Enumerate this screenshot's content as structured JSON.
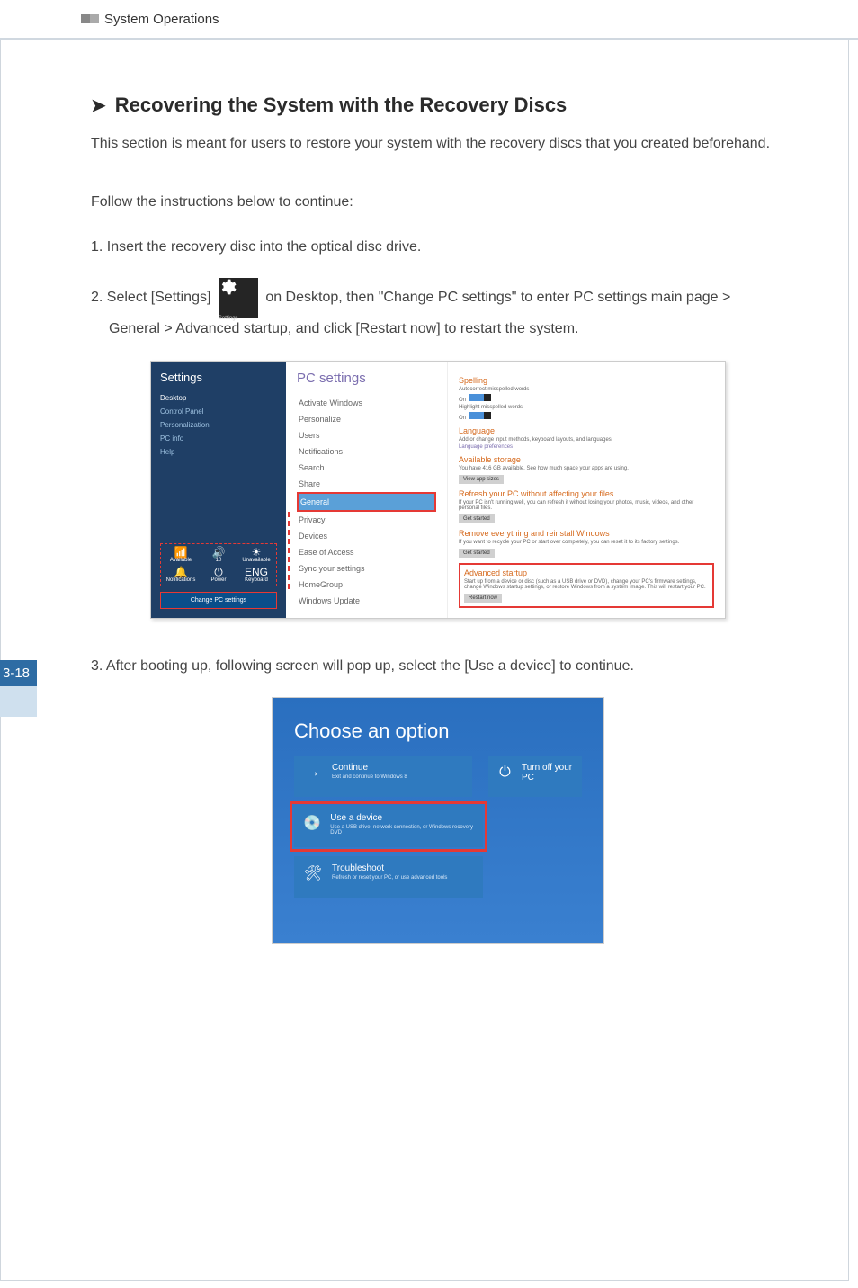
{
  "header": {
    "chapter_title": "System Operations"
  },
  "page_number": "3-18",
  "section": {
    "heading": "Recovering the System with the Recovery Discs",
    "intro": "This section is meant for users to restore your system with the recovery discs that you created beforehand.",
    "instruction_lead": "Follow the instructions below to continue:",
    "step1": "1. Insert the recovery disc into the optical disc drive.",
    "step2_a": "2. Select [Settings] ",
    "step2_b": " on Desktop, then \"Change PC settings\" to enter PC settings main page > General > Advanced startup,  and click [Restart now] to restart the system.",
    "settings_tile_label": "Settings",
    "step3": "3. After booting up, following screen will pop up, select the [Use a device] to continue."
  },
  "fig1": {
    "charm_title": "Settings",
    "charm_links": [
      "Desktop",
      "Control Panel",
      "Personalization",
      "PC info",
      "Help"
    ],
    "charm_tiles": [
      {
        "icon": "📶",
        "label": "Available"
      },
      {
        "icon": "🔊",
        "label": "10"
      },
      {
        "icon": "☀",
        "label": "Unavailable"
      },
      {
        "icon": "🔔",
        "label": "Notifications"
      },
      {
        "icon": "⏻",
        "label": "Power"
      },
      {
        "icon": "ENG",
        "label": "Keyboard"
      }
    ],
    "charm_button": "Change PC settings",
    "mid_title": "PC settings",
    "nav": [
      "Activate Windows",
      "Personalize",
      "Users",
      "Notifications",
      "Search",
      "Share",
      "General",
      "Privacy",
      "Devices",
      "Ease of Access",
      "Sync your settings",
      "HomeGroup",
      "Windows Update"
    ],
    "right": {
      "spelling_hd": "Spelling",
      "spelling_l1": "Autocorrect misspelled words",
      "spelling_l2": "Highlight misspelled words",
      "on": "On",
      "lang_hd": "Language",
      "lang_sub": "Add or change input methods, keyboard layouts, and languages.",
      "lang_link": "Language preferences",
      "storage_hd": "Available storage",
      "storage_sub": "You have 416 GB available. See how much space your apps are using.",
      "storage_btn": "View app sizes",
      "refresh_hd": "Refresh your PC without affecting your files",
      "refresh_sub": "If your PC isn't running well, you can refresh it without losing your photos, music, videos, and other personal files.",
      "get_started": "Get started",
      "remove_hd": "Remove everything and reinstall Windows",
      "remove_sub": "If you want to recycle your PC or start over completely, you can reset it to its factory settings.",
      "adv_hd": "Advanced startup",
      "adv_sub": "Start up from a device or disc (such as a USB drive or DVD), change your PC's firmware settings, change Windows startup settings, or restore Windows from a system image. This will restart your PC.",
      "restart_btn": "Restart now"
    }
  },
  "fig2": {
    "title": "Choose an option",
    "continue_t": "Continue",
    "continue_s": "Exit and continue to Windows 8",
    "turnoff": "Turn off your PC",
    "device_t": "Use a device",
    "device_s": "Use a USB drive, network connection, or Windows recovery DVD",
    "trouble_t": "Troubleshoot",
    "trouble_s": "Refresh or reset your PC, or use advanced tools"
  }
}
